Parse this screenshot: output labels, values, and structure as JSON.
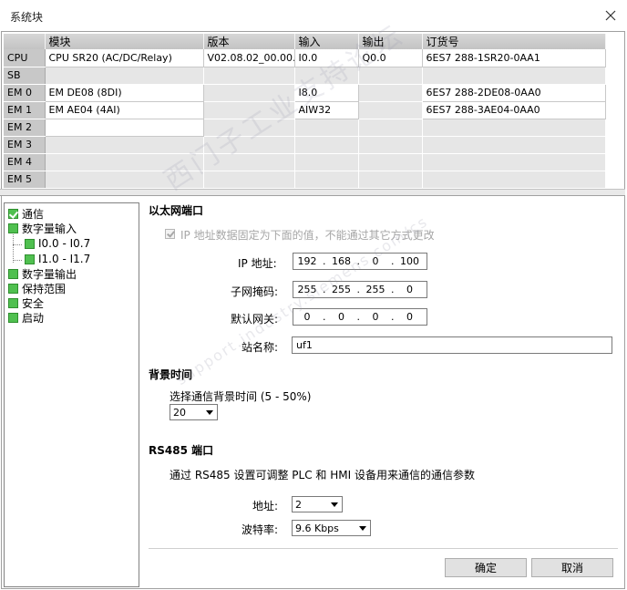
{
  "window": {
    "title": "系统块"
  },
  "table": {
    "headers": [
      "",
      "模块",
      "版本",
      "输入",
      "输出",
      "订货号"
    ],
    "rows": [
      {
        "slot": "CPU",
        "module": "CPU SR20 (AC/DC/Relay)",
        "version": "V02.08.02_00.00...",
        "input": "I0.0",
        "output": "Q0.0",
        "order": "6ES7 288-1SR20-0AA1"
      },
      {
        "slot": "SB",
        "module": "",
        "version": "",
        "input": "",
        "output": "",
        "order": ""
      },
      {
        "slot": "EM 0",
        "module": "EM DE08 (8DI)",
        "version": "",
        "input": "I8.0",
        "output": "",
        "order": "6ES7 288-2DE08-0AA0"
      },
      {
        "slot": "EM 1",
        "module": "EM AE04 (4AI)",
        "version": "",
        "input": "AIW32",
        "output": "",
        "order": "6ES7 288-3AE04-0AA0"
      },
      {
        "slot": "EM 2",
        "module": "",
        "version": "",
        "input": "",
        "output": "",
        "order": ""
      },
      {
        "slot": "EM 3",
        "module": "",
        "version": "",
        "input": "",
        "output": "",
        "order": ""
      },
      {
        "slot": "EM 4",
        "module": "",
        "version": "",
        "input": "",
        "output": "",
        "order": ""
      },
      {
        "slot": "EM 5",
        "module": "",
        "version": "",
        "input": "",
        "output": "",
        "order": ""
      }
    ]
  },
  "tree": {
    "items": [
      {
        "label": "通信"
      },
      {
        "label": "数字量输入"
      },
      {
        "label": "I0.0 - I0.7"
      },
      {
        "label": "I1.0 - I1.7"
      },
      {
        "label": "数字量输出"
      },
      {
        "label": "保持范围"
      },
      {
        "label": "安全"
      },
      {
        "label": "启动"
      }
    ]
  },
  "ethernet": {
    "title": "以太网端口",
    "fixed_ip_label": "IP 地址数据固定为下面的值，不能通过其它方式更改",
    "ip_label": "IP 地址:",
    "ip": [
      "192",
      "168",
      "0",
      "100"
    ],
    "mask_label": "子网掩码:",
    "mask": [
      "255",
      "255",
      "255",
      "0"
    ],
    "gateway_label": "默认网关:",
    "gateway": [
      "0",
      "0",
      "0",
      "0"
    ],
    "station_label": "站名称:",
    "station": "uf1"
  },
  "background": {
    "title": "背景时间",
    "select_label": "选择通信背景时间 (5 - 50%)",
    "value": "20"
  },
  "rs485": {
    "title": "RS485 端口",
    "desc": "通过 RS485 设置可调整 PLC 和 HMI 设备用来通信的通信参数",
    "address_label": "地址:",
    "address": "2",
    "baud_label": "波特率:",
    "baud": "9.6 Kbps"
  },
  "buttons": {
    "ok": "确定",
    "cancel": "取消"
  },
  "watermark": {
    "line1": "西门子工业支持论坛",
    "line2": "support.industry.siemens.com/cs"
  },
  "colors": {
    "tree_check": "#50c050",
    "header_bg": "#c8c8c8"
  }
}
